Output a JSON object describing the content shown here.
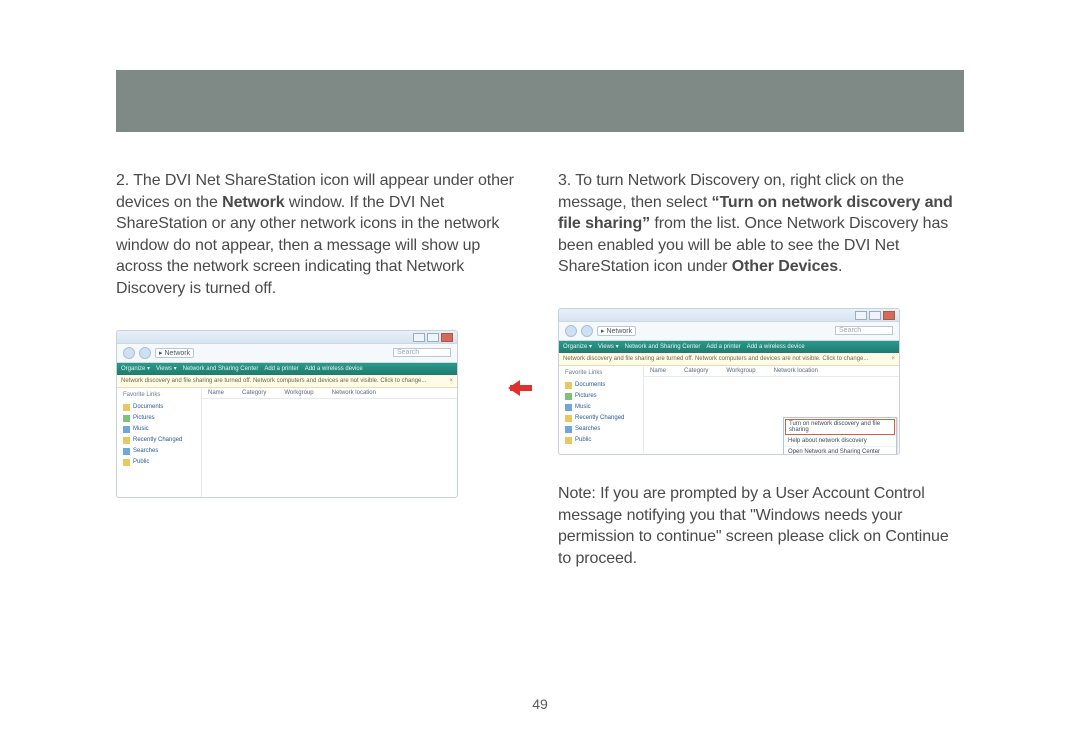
{
  "page_number": "49",
  "left": {
    "step_label": "2.",
    "text_pre": "The DVI Net ShareStation icon will appear under other devices on the ",
    "bold1": "Network",
    "text_post": " window. If the DVI Net ShareStation or any other network icons in the network window do not appear, then a message will show up across the network screen indicating that Network Discovery is turned off."
  },
  "right": {
    "step_label": "3.",
    "text_pre": "To turn Network Discovery on, right click on the message, then select ",
    "bold1": "“Turn on network discovery and file sharing”",
    "text_mid": " from the list.  Once Network Discovery has been enabled you will be able to see the DVI Net ShareStation icon under ",
    "bold2": "Other Devices",
    "text_post": ".",
    "note": "Note: If you are prompted by a User Account Control message notifying you that \"Windows needs your permission to continue\" screen please click on Continue to proceed."
  },
  "shot": {
    "breadcrumb_arrow": "▸",
    "breadcrumb": "Network",
    "search_placeholder": "Search",
    "toolbar": {
      "organize": "Organize ▾",
      "views": "Views ▾",
      "nsc": "Network and Sharing Center",
      "addprinter": "Add a printer",
      "addwireless": "Add a wireless device"
    },
    "infobar": "Network discovery and file sharing are turned off. Network computers and devices are not visible. Click to change...",
    "infobar_close": "×",
    "favtitle": "Favorite Links",
    "favs": {
      "documents": "Documents",
      "pictures": "Pictures",
      "music": "Music",
      "recently": "Recently Changed",
      "searches": "Searches",
      "public": "Public"
    },
    "listheads": {
      "name": "Name",
      "category": "Category",
      "workgroup": "Workgroup",
      "netloc": "Network location"
    },
    "ctx": {
      "turn_on": "Turn on network discovery and file sharing",
      "help": "Help about network discovery",
      "open_nsc": "Open Network and Sharing Center"
    }
  }
}
